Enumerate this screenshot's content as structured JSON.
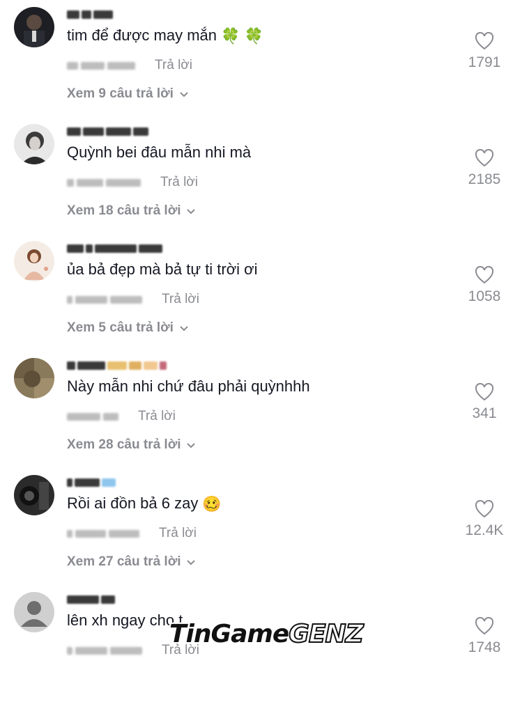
{
  "comments": [
    {
      "text": "tim để được may mắn",
      "emoji": "🍀 🍀",
      "reply_label": "Trả lời",
      "likes": "1791",
      "view_replies": "Xem 9 câu trả lời"
    },
    {
      "text": "Quỳnh bei đâu mẫn nhi mà",
      "emoji": "",
      "reply_label": "Trả lời",
      "likes": "2185",
      "view_replies": "Xem 18 câu trả lời"
    },
    {
      "text": "ủa bả đẹp mà bả tự ti trời ơi",
      "emoji": "",
      "reply_label": "Trả lời",
      "likes": "1058",
      "view_replies": "Xem 5 câu trả lời"
    },
    {
      "text": "Này mẫn nhi chứ đâu phải quỳnhhh",
      "emoji": "",
      "reply_label": "Trả lời",
      "likes": "341",
      "view_replies": "Xem 28 câu trả lời"
    },
    {
      "text": "Rồi ai đồn bả 6 zay",
      "emoji": "🥴",
      "reply_label": "Trả lời",
      "likes": "12.4K",
      "view_replies": "Xem 27 câu trả lời"
    },
    {
      "text": "lên xh ngay cho t",
      "emoji": "",
      "reply_label": "Trả lời",
      "likes": "1748",
      "view_replies": ""
    }
  ],
  "watermark": {
    "part1": "TinGame",
    "part2": "GENZ"
  },
  "colors": {
    "text": "#161823",
    "muted": "#8a8b91",
    "background": "#ffffff"
  }
}
